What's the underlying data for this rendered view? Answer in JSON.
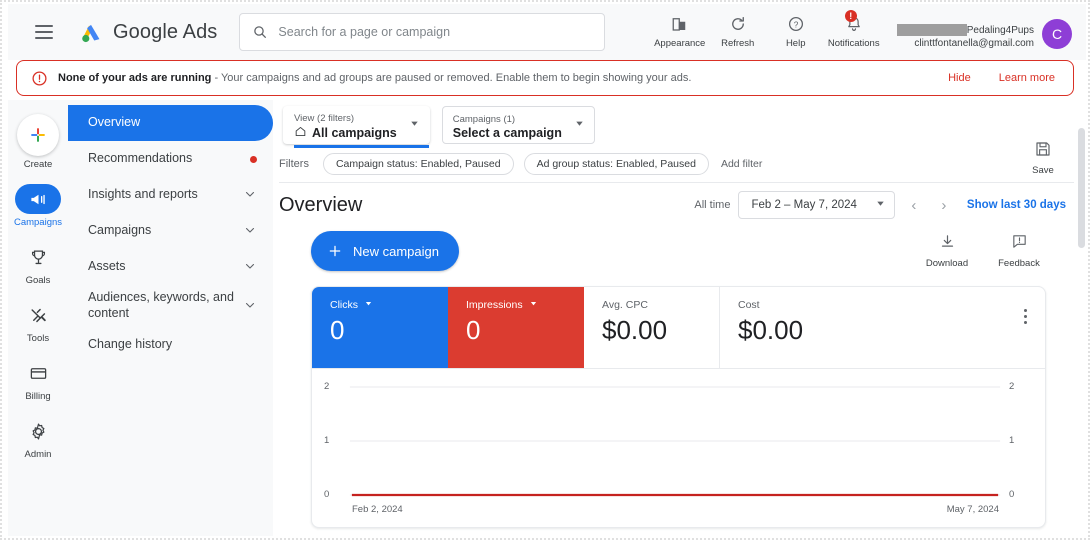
{
  "header": {
    "menu_icon": "hamburger-icon",
    "brand": "Google Ads",
    "search": {
      "placeholder": "Search for a page or campaign",
      "value": "",
      "icon": "search-icon"
    },
    "icons": [
      {
        "name": "appearance-icon",
        "label": "Appearance"
      },
      {
        "name": "refresh-icon",
        "label": "Refresh"
      },
      {
        "name": "help-icon",
        "label": "Help"
      },
      {
        "name": "notifications-icon",
        "label": "Notifications",
        "badge": "!"
      }
    ],
    "account": {
      "name": "Pedaling4Pups",
      "email": "clinttfontanella@gmail.com",
      "avatar_initial": "C",
      "avatar_color": "#8e3ed6",
      "redacted": true
    }
  },
  "banner": {
    "icon": "alert-circle-icon",
    "title": "None of your ads are running",
    "separator": " - ",
    "description": "Your campaigns and ad groups are paused or removed. Enable them to begin showing your ads.",
    "hide_label": "Hide",
    "learn_more_label": "Learn more",
    "accent": "#d93025"
  },
  "rail": {
    "items": [
      {
        "name": "create",
        "label": "Create",
        "icon": "plus-icon",
        "active": false
      },
      {
        "name": "campaigns",
        "label": "Campaigns",
        "icon": "campaign-megaphone-icon",
        "active": true
      },
      {
        "name": "goals",
        "label": "Goals",
        "icon": "trophy-icon",
        "active": false
      },
      {
        "name": "tools",
        "label": "Tools",
        "icon": "tools-icon",
        "active": false
      },
      {
        "name": "billing",
        "label": "Billing",
        "icon": "credit-card-icon",
        "active": false
      },
      {
        "name": "admin",
        "label": "Admin",
        "icon": "gear-icon",
        "active": false
      }
    ]
  },
  "sidebar": {
    "items": [
      {
        "label": "Overview",
        "active": true,
        "chevron": false,
        "dot": false
      },
      {
        "label": "Recommendations",
        "active": false,
        "chevron": false,
        "dot": true
      },
      {
        "label": "Insights and reports",
        "active": false,
        "chevron": true,
        "dot": false
      },
      {
        "label": "Campaigns",
        "active": false,
        "chevron": true,
        "dot": false
      },
      {
        "label": "Assets",
        "active": false,
        "chevron": true,
        "dot": false
      },
      {
        "label": "Audiences, keywords, and content",
        "active": false,
        "chevron": true,
        "dot": false
      },
      {
        "label": "Change history",
        "active": false,
        "chevron": false,
        "dot": false
      }
    ]
  },
  "toolbar": {
    "view_selector": {
      "top_label": "View (2 filters)",
      "value": "All campaigns",
      "icon": "home-icon"
    },
    "campaign_selector": {
      "top_label": "Campaigns (1)",
      "value": "Select a campaign"
    },
    "filters_label": "Filters",
    "chips": [
      "Campaign status: Enabled, Paused",
      "Ad group status: Enabled, Paused"
    ],
    "add_filter_label": "Add filter",
    "save": {
      "label": "Save",
      "icon": "save-floppy-icon"
    }
  },
  "main": {
    "page_title": "Overview",
    "all_time_label": "All time",
    "date_range": "Feb 2 – May 7, 2024",
    "prev_arrow": "‹",
    "next_arrow": "›",
    "show_last_30_days": "Show last 30 days",
    "new_campaign_label": "New campaign",
    "right_actions": [
      {
        "name": "download-icon",
        "label": "Download"
      },
      {
        "name": "feedback-icon",
        "label": "Feedback"
      }
    ],
    "kebab": "more-options-icon"
  },
  "metrics": [
    {
      "label": "Clicks",
      "value": "0",
      "style": "blue",
      "has_dropdown": true
    },
    {
      "label": "Impressions",
      "value": "0",
      "style": "red",
      "has_dropdown": true
    },
    {
      "label": "Avg. CPC",
      "value": "$0.00",
      "style": "plain",
      "has_dropdown": false
    },
    {
      "label": "Cost",
      "value": "$0.00",
      "style": "plain",
      "has_dropdown": false
    }
  ],
  "chart_data": {
    "type": "line",
    "title": "",
    "xlabel": "",
    "ylabel": "",
    "x_tick_labels": [
      "Feb 2, 2024",
      "May 7, 2024"
    ],
    "y_tick_labels_left": [
      "2",
      "1",
      "0"
    ],
    "y_tick_labels_right": [
      "2",
      "1",
      "0"
    ],
    "ylim": [
      0,
      2
    ],
    "grid": true,
    "legend": "none",
    "series": [
      {
        "name": "Clicks",
        "color": "#1a73e8",
        "values": [
          0,
          0,
          0,
          0,
          0,
          0,
          0,
          0,
          0,
          0
        ]
      },
      {
        "name": "Impressions",
        "color": "#c5221f",
        "values": [
          0,
          0,
          0,
          0,
          0,
          0,
          0,
          0,
          0,
          0
        ]
      }
    ]
  },
  "colors": {
    "blue": "#1a73e8",
    "red": "#db3c30",
    "alert": "#d93025",
    "chart_line": "#c5221f",
    "sidebar_bg": "#f8f9fa"
  }
}
